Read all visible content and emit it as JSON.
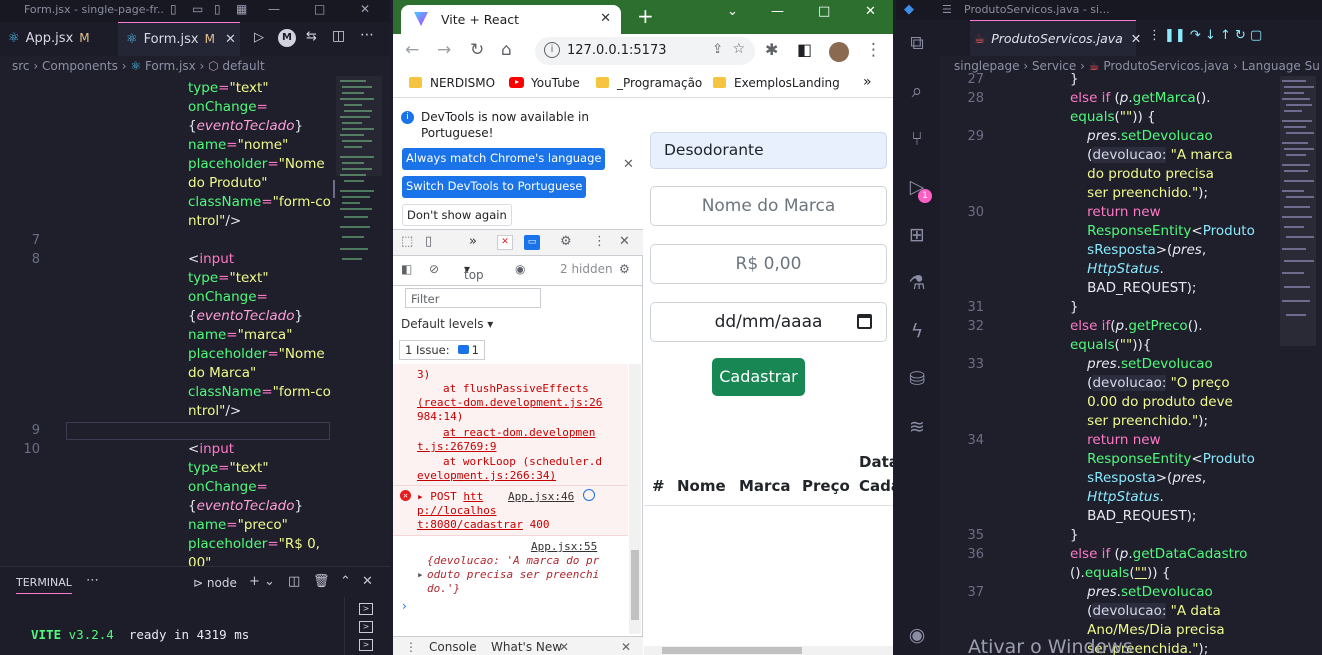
{
  "left_editor": {
    "title": "Form.jsx - single-page-fr...",
    "tabs": [
      {
        "label": "App.jsx",
        "status": "M"
      },
      {
        "label": "Form.jsx",
        "status": "M"
      }
    ],
    "breadcrumb": {
      "src": "src",
      "components": "Components",
      "file": "Form.jsx",
      "symbol": "default"
    },
    "line_numbers": [
      "7",
      "8",
      "9",
      "10"
    ],
    "terminal": {
      "tab": "TERMINAL",
      "shell": "node",
      "output_name": "VITE",
      "output_version": "v3.2.4",
      "output_ready": "ready in",
      "output_time": "4319 ms"
    }
  },
  "browser": {
    "tab_title": "Vite + React",
    "url": "127.0.0.1:5173",
    "bookmarks": [
      "NERDISMO",
      "YouTube",
      "_Programação",
      "ExemplosLanding"
    ],
    "devtools": {
      "banner_message": "DevTools is now available in Portuguese!",
      "btn_match": "Always match Chrome's language",
      "btn_switch": "Switch DevTools to Portuguese",
      "btn_dont_show": "Don't show again",
      "context": "top",
      "hidden_count": "2 hidden",
      "filter_placeholder": "Filter",
      "default_levels": "Default levels",
      "issues_label": "1 Issue:",
      "issues_count": "1",
      "stack": {
        "l1": "3)",
        "l2": "at flushPassiveEffects",
        "l3": "(react-dom.development.js:26",
        "l4": "984:14)",
        "l5": "at react-dom.developmen",
        "l6": "t.js:26769:9",
        "l7": "at workLoop (scheduler.d",
        "l8": "evelopment.js:266:34)"
      },
      "post_error": {
        "method": "POST",
        "url1": "htt",
        "url2": "p://localhos",
        "url3": "t:8080/cadastrar",
        "status": "400",
        "source": "App.jsx:46"
      },
      "log": {
        "source": "App.jsx:55",
        "l1": "{devolucao: 'A marca do pr",
        "l2": "oduto precisa ser preenchi",
        "l3": "do.'}"
      },
      "drawer_tabs": [
        "Console",
        "What's New"
      ]
    },
    "page": {
      "field_product_value": "Desodorante",
      "field_brand_placeholder": "Nome do Marca",
      "field_price_placeholder": "R$ 0,00",
      "field_date_placeholder": "dd/mm/aaaa",
      "submit_label": "Cadastrar",
      "table_headers": [
        "#",
        "Nome",
        "Marca",
        "Preço",
        "Data",
        "Cada"
      ]
    }
  },
  "right_editor": {
    "title": "ProdutoServicos.java - si...",
    "tab": "ProdutoServicos.java",
    "breadcrumb": [
      "singlepage",
      "Service",
      "ProdutoServicos.java",
      "Language Su"
    ],
    "line_numbers": [
      "27",
      "28",
      "29",
      "30",
      "31",
      "32",
      "33",
      "34",
      "35",
      "36",
      "37"
    ],
    "debug_badge": "1",
    "watermark": "Ativar o Windows"
  },
  "colors": {
    "editor_bg": "#1e1f2b",
    "accent_pink": "#ff79c6",
    "string_yellow": "#f1fa8c",
    "attr_green": "#50fa7b",
    "chrome_green": "#2d6f2f",
    "button_green": "#198754",
    "devtools_blue": "#1a73e8"
  }
}
